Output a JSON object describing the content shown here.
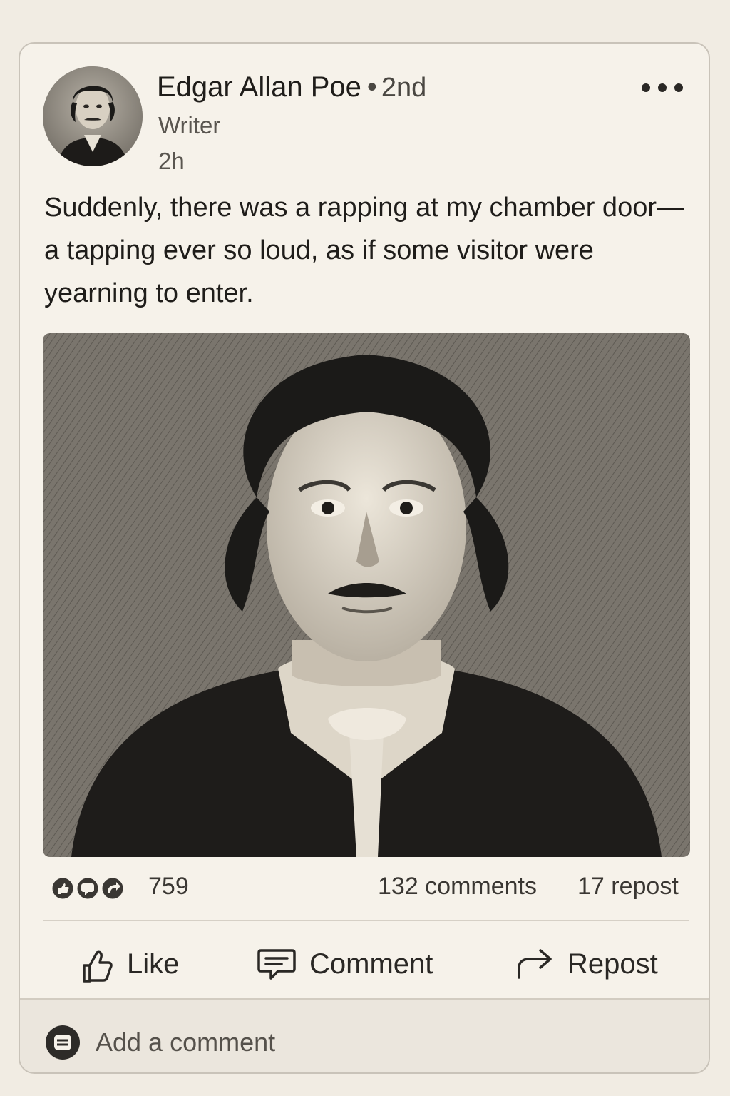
{
  "post": {
    "author": {
      "name": "Edgar Allan Poe",
      "separator": "•",
      "degree": "2nd",
      "title": "Writer",
      "time": "2h",
      "avatar_icon": "portrait-avatar"
    },
    "menu_icon": "more-options-icon",
    "text": "Suddenly, there was a rapping at my chamber door—a tapping ever so loud, as if some visitor were yearning to enter.",
    "image_icon": "engraved-portrait-image"
  },
  "stats": {
    "reactions": "759",
    "comments": "132 comments",
    "reposts": "17 repost",
    "reaction_icons": [
      "like-reaction-icon",
      "comment-reaction-icon",
      "repost-reaction-icon"
    ]
  },
  "actions": {
    "like": "Like",
    "comment": "Comment",
    "repost": "Repost"
  },
  "comment_box": {
    "placeholder": "Add a comment"
  },
  "colors": {
    "page_background": "#f1ece3",
    "card_background": "#f6f2ea",
    "border": "#c9c3b9",
    "text": "#1f1d1a",
    "muted_text": "#5a5650"
  }
}
